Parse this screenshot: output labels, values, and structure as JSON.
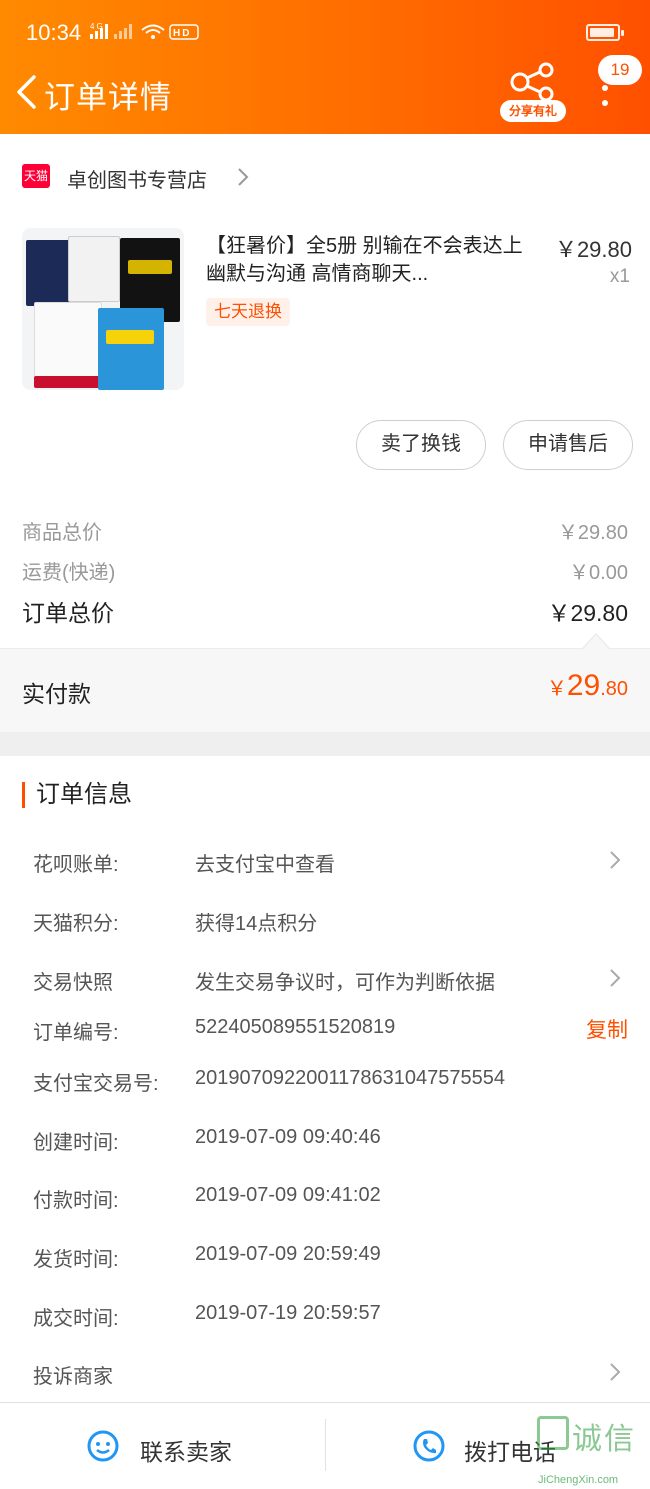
{
  "status_bar": {
    "time": "10:34",
    "network": "4G",
    "hd": "HD"
  },
  "header": {
    "title": "订单详情",
    "share_label": "分享有礼",
    "message_count": "19"
  },
  "shop": {
    "platform_logo": "天猫",
    "name": "卓创图书专营店"
  },
  "product": {
    "title": "【狂暑价】全5册 别输在不会表达上 幽默与沟通 高情商聊天...",
    "price": "￥29.80",
    "qty": "x1",
    "tag": "七天退换"
  },
  "actions": {
    "sell_label": "卖了换钱",
    "after_sale_label": "申请售后"
  },
  "summary": {
    "goods_total_label": "商品总价",
    "goods_total_value": "￥29.80",
    "shipping_label": "运费(快递)",
    "shipping_value": "￥0.00",
    "order_total_label": "订单总价",
    "order_total_value": "￥29.80",
    "paid_label": "实付款",
    "paid_symbol": "￥",
    "paid_int": "29",
    "paid_dec": ".80"
  },
  "order_info": {
    "title": "订单信息",
    "rows": [
      {
        "key": "花呗账单:",
        "value": "去支付宝中查看"
      },
      {
        "key": "天猫积分:",
        "value": "获得14点积分"
      },
      {
        "key": "交易快照",
        "value": "发生交易争议时，可作为判断依据"
      },
      {
        "key": "订单编号:",
        "value": "522405089551520819"
      },
      {
        "key": "支付宝交易号:",
        "value": "2019070922001178631047575554"
      },
      {
        "key": "创建时间:",
        "value": "2019-07-09 09:40:46"
      },
      {
        "key": "付款时间:",
        "value": "2019-07-09 09:41:02"
      },
      {
        "key": "发货时间:",
        "value": "2019-07-09 20:59:49"
      },
      {
        "key": "成交时间:",
        "value": "2019-07-19 20:59:57"
      },
      {
        "key": "投诉商家",
        "value": ""
      }
    ],
    "copy_label": "复制"
  },
  "bottom": {
    "contact_label": "联系卖家",
    "call_label": "拨打电话"
  },
  "watermark": {
    "text": "诚信",
    "sub": "JiChengXin.com"
  },
  "colors": {
    "brand": "#ff5000",
    "header_start": "#ff8a00",
    "tmall": "#ff0036",
    "icon_blue": "#2196f3"
  }
}
